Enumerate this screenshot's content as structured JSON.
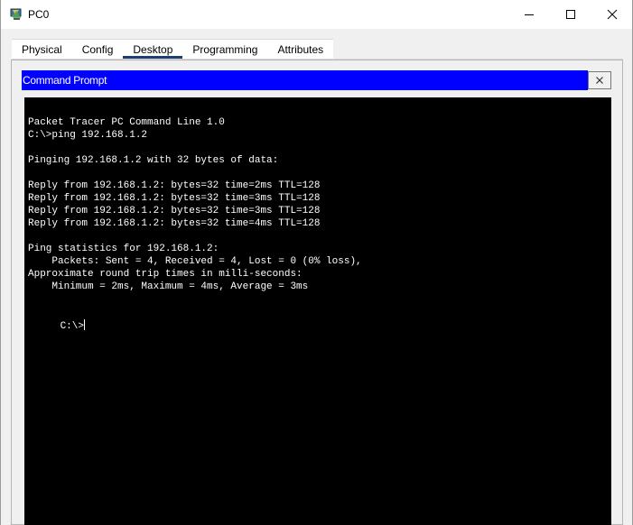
{
  "window": {
    "title": "PC0",
    "app_icon": "packet-tracer-pc-icon",
    "controls": {
      "minimize_icon": "minimize-icon",
      "maximize_icon": "maximize-icon",
      "close_icon": "close-icon"
    }
  },
  "tabs": [
    {
      "label": "Physical",
      "active": false
    },
    {
      "label": "Config",
      "active": false
    },
    {
      "label": "Desktop",
      "active": true
    },
    {
      "label": "Programming",
      "active": false
    },
    {
      "label": "Attributes",
      "active": false
    }
  ],
  "command_prompt": {
    "title": "Command Prompt",
    "close_label": "X",
    "header_color": "#0000ff",
    "background_color": "#000000",
    "text_color": "#ffffff",
    "lines": [
      "Packet Tracer PC Command Line 1.0",
      "C:\\>ping 192.168.1.2",
      "",
      "Pinging 192.168.1.2 with 32 bytes of data:",
      "",
      "Reply from 192.168.1.2: bytes=32 time=2ms TTL=128",
      "Reply from 192.168.1.2: bytes=32 time=3ms TTL=128",
      "Reply from 192.168.1.2: bytes=32 time=3ms TTL=128",
      "Reply from 192.168.1.2: bytes=32 time=4ms TTL=128",
      "",
      "Ping statistics for 192.168.1.2:",
      "    Packets: Sent = 4, Received = 4, Lost = 0 (0% loss),",
      "Approximate round trip times in milli-seconds:",
      "    Minimum = 2ms, Maximum = 4ms, Average = 3ms",
      ""
    ],
    "prompt": "C:\\>"
  }
}
